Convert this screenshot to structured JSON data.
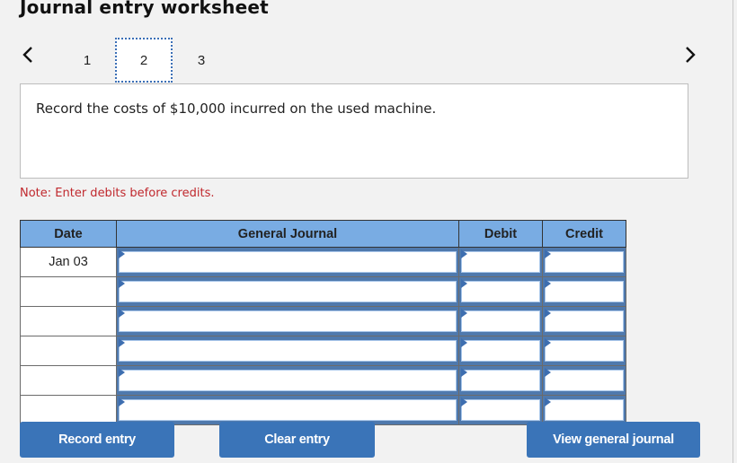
{
  "page": {
    "title": "Journal entry worksheet"
  },
  "nav": {
    "prev_icon": "chevron-left-icon",
    "next_icon": "chevron-right-icon",
    "tabs": [
      {
        "label": "1",
        "active": false
      },
      {
        "label": "2",
        "active": true
      },
      {
        "label": "3",
        "active": false
      }
    ]
  },
  "prompt": {
    "text": "Record the costs of $10,000 incurred on the used machine."
  },
  "note": {
    "text": "Note: Enter debits before credits."
  },
  "table": {
    "headers": {
      "date": "Date",
      "journal": "General Journal",
      "debit": "Debit",
      "credit": "Credit"
    },
    "rows": [
      {
        "date": "Jan 03",
        "account": "",
        "debit": "",
        "credit": ""
      },
      {
        "date": "",
        "account": "",
        "debit": "",
        "credit": ""
      },
      {
        "date": "",
        "account": "",
        "debit": "",
        "credit": ""
      },
      {
        "date": "",
        "account": "",
        "debit": "",
        "credit": ""
      },
      {
        "date": "",
        "account": "",
        "debit": "",
        "credit": ""
      },
      {
        "date": "",
        "account": "",
        "debit": "",
        "credit": ""
      }
    ]
  },
  "buttons": {
    "record": "Record entry",
    "clear": "Clear entry",
    "view": "View general journal"
  },
  "colors": {
    "accent": "#3a74b8",
    "header": "#79ace3",
    "note": "#c0282d"
  }
}
